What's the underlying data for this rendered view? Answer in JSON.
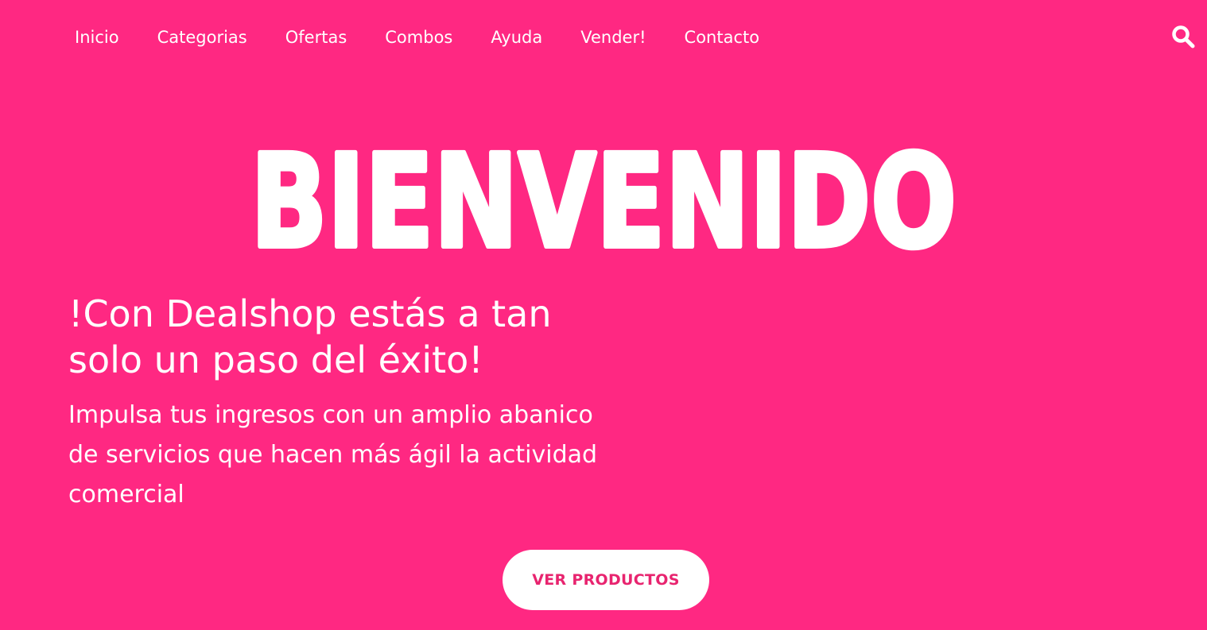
{
  "nav": {
    "items": [
      {
        "label": "Inicio"
      },
      {
        "label": "Categorias"
      },
      {
        "label": "Ofertas"
      },
      {
        "label": "Combos"
      },
      {
        "label": "Ayuda"
      },
      {
        "label": "Vender!"
      },
      {
        "label": "Contacto"
      }
    ],
    "search_icon": "search-icon"
  },
  "hero": {
    "title": "BIENVENIDO",
    "tagline": "!Con Dealshop estás a tan solo un paso del éxito!",
    "subtitle": "Impulsa tus ingresos con un amplio abanico de servicios que hacen más ágil la actividad comercial",
    "cta_label": "VER PRODUCTOS"
  },
  "colors": {
    "background": "#ff2882",
    "text": "#ffffff",
    "cta_text": "#e8246f",
    "cta_background": "#ffffff"
  }
}
